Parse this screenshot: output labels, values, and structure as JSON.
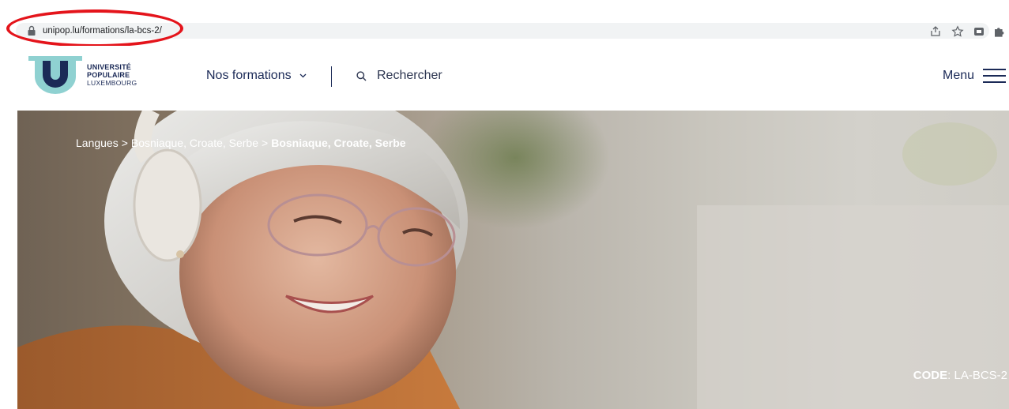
{
  "browser": {
    "url": "unipop.lu/formations/la-bcs-2/",
    "icons": [
      "share-icon",
      "star-icon",
      "extension-icon",
      "puzzle-icon"
    ]
  },
  "logo": {
    "line1": "UNIVERSITÉ",
    "line2": "POPULAIRE",
    "line3": "LUXEMBOURG",
    "mark_letter": "U"
  },
  "nav": {
    "formations_label": "Nos formations",
    "search_placeholder": "Rechercher",
    "menu_label": "Menu"
  },
  "breadcrumb": {
    "items": [
      "Langues",
      "Bosniaque, Croate, Serbe"
    ],
    "separator": ">",
    "current": "Bosniaque, Croate, Serbe"
  },
  "course": {
    "code_label": "CODE",
    "code_value": ": LA-BCS-2"
  },
  "colors": {
    "brand_navy": "#1b2a57",
    "brand_teal": "#8fd1d1",
    "highlight_red": "#e4141b"
  }
}
